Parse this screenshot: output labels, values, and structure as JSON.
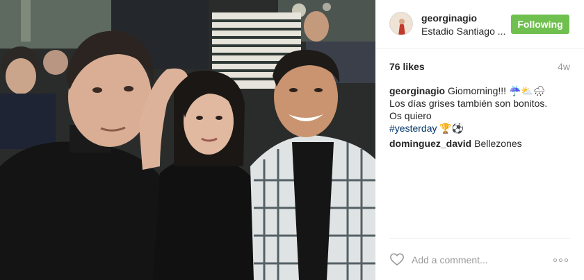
{
  "post": {
    "author": {
      "username": "georginagio",
      "location": "Estadio Santiago ..."
    },
    "follow_button_label": "Following",
    "follow_button_color": "#70c050",
    "likes_label": "76 likes",
    "time_ago": "4w",
    "caption": {
      "username": "georginagio",
      "line1": "Giomorning!!! ☔️⛅️🌧",
      "line2": "Los días grises también son bonitos.",
      "line3": "Os quiero",
      "hashtag": "#yesterday",
      "emojis": "🏆⚽️"
    },
    "comments": [
      {
        "username": "dominguez_david",
        "text": "Bellezones"
      }
    ],
    "add_comment_placeholder": "Add a comment...",
    "icons": {
      "like": "heart-outline-icon",
      "more": "more-options-icon"
    },
    "colors": {
      "hashtag": "#003569",
      "muted": "#999999",
      "text": "#262626"
    }
  }
}
